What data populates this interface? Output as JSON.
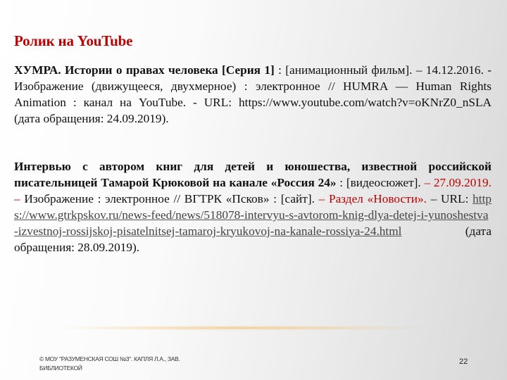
{
  "slide": {
    "title": "Ролик на YouTube",
    "entry1": {
      "bold_title": "ХУМРА. Истории о правах человека [Серия 1]",
      "rest": " : [анимационный фильм]. – 14.12.2016. - Изображение (движущееся, двухмерное) : электронное // HUMRA — Human Rights Animation : канал на YouTube. - URL: https://www.youtube.com/watch?v=oKNrZ0_nSLA (дата обращения: 24.09.2019)."
    },
    "entry2": {
      "bold_title": "Интервью с автором книг для детей и юношества, известной российской писательницей Тамарой Крюковой на канале «Россия 24»",
      "type_note": " : [видеосюжет]. ",
      "date_red": "– 27.09.2019. –",
      "desc": " Изображение : электронное //  ВГТРК «Псков» : [сайт]. ",
      "dash_red": "–",
      "section_red": " Раздел «Новости». ",
      "url_label_prefix": "– URL: ",
      "url": "https://www.gtrkpskov.ru/news-feed/news/518078-intervyu-s-avtorom-knig-dlya-detej-i-yunoshestva-izvestnoj-rossijskoj-pisatelnitsej-tamaroj-kryukovoj-na-kanale-rossiya-24.html",
      "access_date": " (дата обращения: 28.09.2019)."
    },
    "footer": {
      "copyright": "© МОУ \"РАЗУМЕНСКАЯ СОШ №3\". КАПЛЯ Л.А., ЗАВ. БИБЛИОТЕКОЙ",
      "page_number": "22"
    },
    "colors": {
      "accent_red": "#c00000",
      "link_gray": "#444444",
      "glow_orange": "#f0aa3c"
    }
  }
}
